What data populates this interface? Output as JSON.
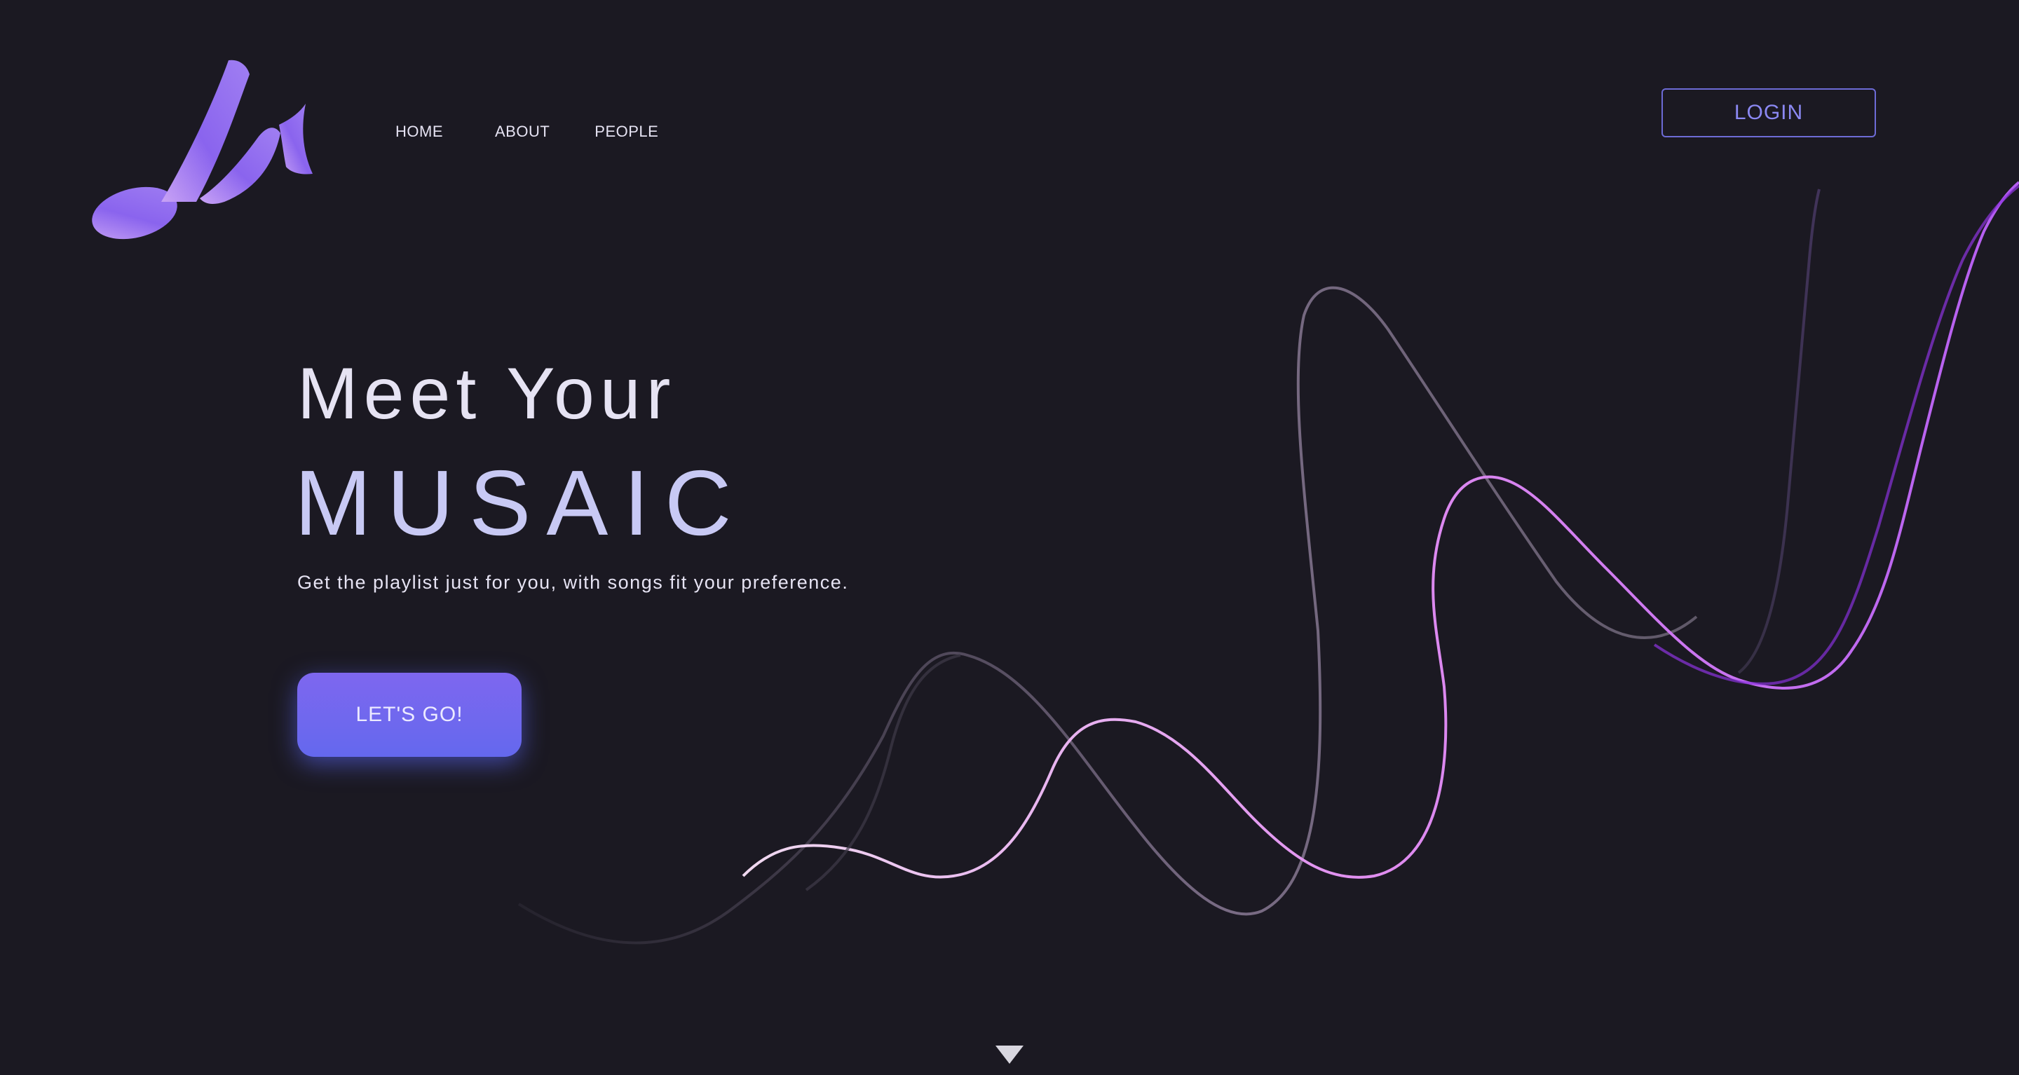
{
  "brand": {
    "logo_icon": "music-note-m-logo",
    "accent": "#8b6cf0"
  },
  "nav": {
    "home_label": "HOME",
    "about_label": "ABOUT",
    "people_label": "PEOPLE"
  },
  "header": {
    "login_label": "LOGIN"
  },
  "hero": {
    "pretitle": "Meet Your",
    "title": "MUSAIC",
    "tagline": "Get the playlist just for you, with songs fit your preference.",
    "cta_label": "LET'S GO!"
  },
  "scroll": {
    "icon": "triangle-down-icon"
  },
  "colors": {
    "background": "#1b1922",
    "login_border": "#6d6bd6",
    "cta_gradient_top": "#7e67ef",
    "cta_gradient_bottom": "#6468ee",
    "title": "#c8c9f4"
  }
}
